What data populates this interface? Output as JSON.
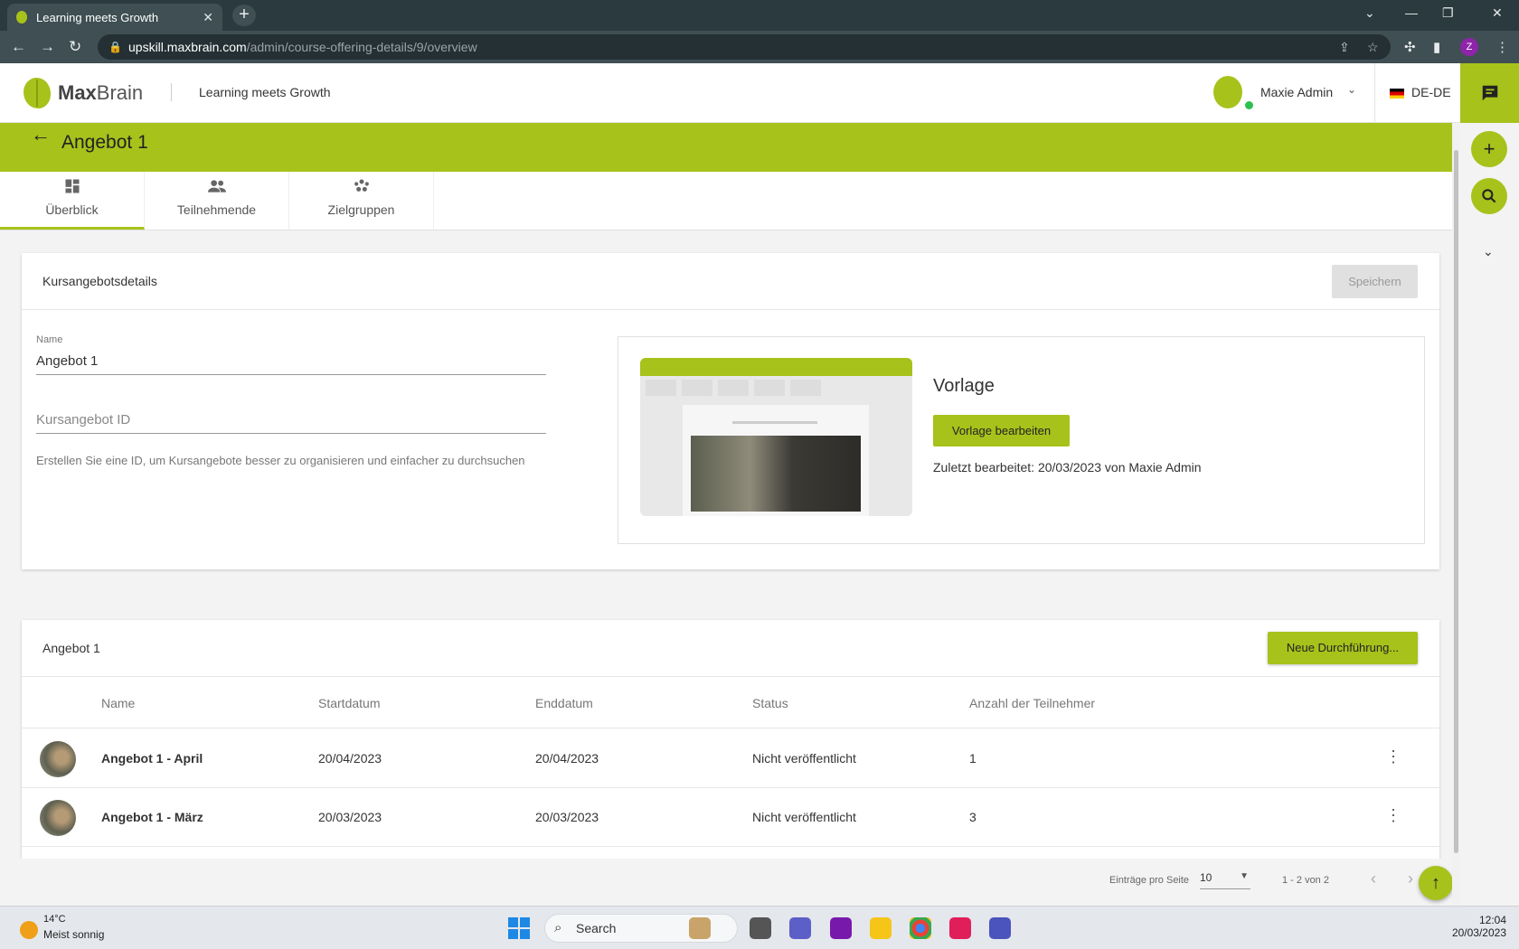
{
  "browser": {
    "tab_title": "Learning meets Growth",
    "url_host": "upskill.maxbrain.com",
    "url_path": "/admin/course-offering-details/9/overview",
    "profile_initial": "Z"
  },
  "header": {
    "brand_bold": "Max",
    "brand_rest": "Brain",
    "app_title": "Learning meets Growth",
    "user_name": "Maxie Admin",
    "language": "DE-DE"
  },
  "page": {
    "title": "Angebot 1"
  },
  "tabs": [
    {
      "label": "Überblick",
      "icon": "dashboard-icon",
      "active": true
    },
    {
      "label": "Teilnehmende",
      "icon": "people-icon",
      "active": false
    },
    {
      "label": "Zielgruppen",
      "icon": "groups-icon",
      "active": false
    }
  ],
  "details_card": {
    "title": "Kursangebotsdetails",
    "save_label": "Speichern",
    "name_label": "Name",
    "name_value": "Angebot 1",
    "id_placeholder": "Kursangebot ID",
    "id_hint": "Erstellen Sie eine ID, um Kursangebote besser zu organisieren und einfacher zu durchsuchen",
    "template_title": "Vorlage",
    "template_button": "Vorlage bearbeiten",
    "template_meta": "Zuletzt bearbeitet: 20/03/2023 von Maxie Admin"
  },
  "runs_card": {
    "title": "Angebot 1",
    "new_button": "Neue Durchführung...",
    "columns": [
      "Name",
      "Startdatum",
      "Enddatum",
      "Status",
      "Anzahl der Teilnehmer"
    ],
    "rows": [
      {
        "name": "Angebot 1 - April",
        "start": "20/04/2023",
        "end": "20/04/2023",
        "status": "Nicht veröffentlicht",
        "count": "1"
      },
      {
        "name": "Angebot 1 - März",
        "start": "20/03/2023",
        "end": "20/03/2023",
        "status": "Nicht veröffentlicht",
        "count": "3"
      }
    ]
  },
  "pagination": {
    "per_page_label": "Einträge pro Seite",
    "per_page_value": "10",
    "range": "1 - 2 von 2"
  },
  "taskbar": {
    "temp": "14°C",
    "weather": "Meist sonnig",
    "search_label": "Search",
    "time": "12:04",
    "date": "20/03/2023"
  },
  "colors": {
    "accent": "#a7c21b",
    "browser_dark": "#2b3a3e"
  }
}
